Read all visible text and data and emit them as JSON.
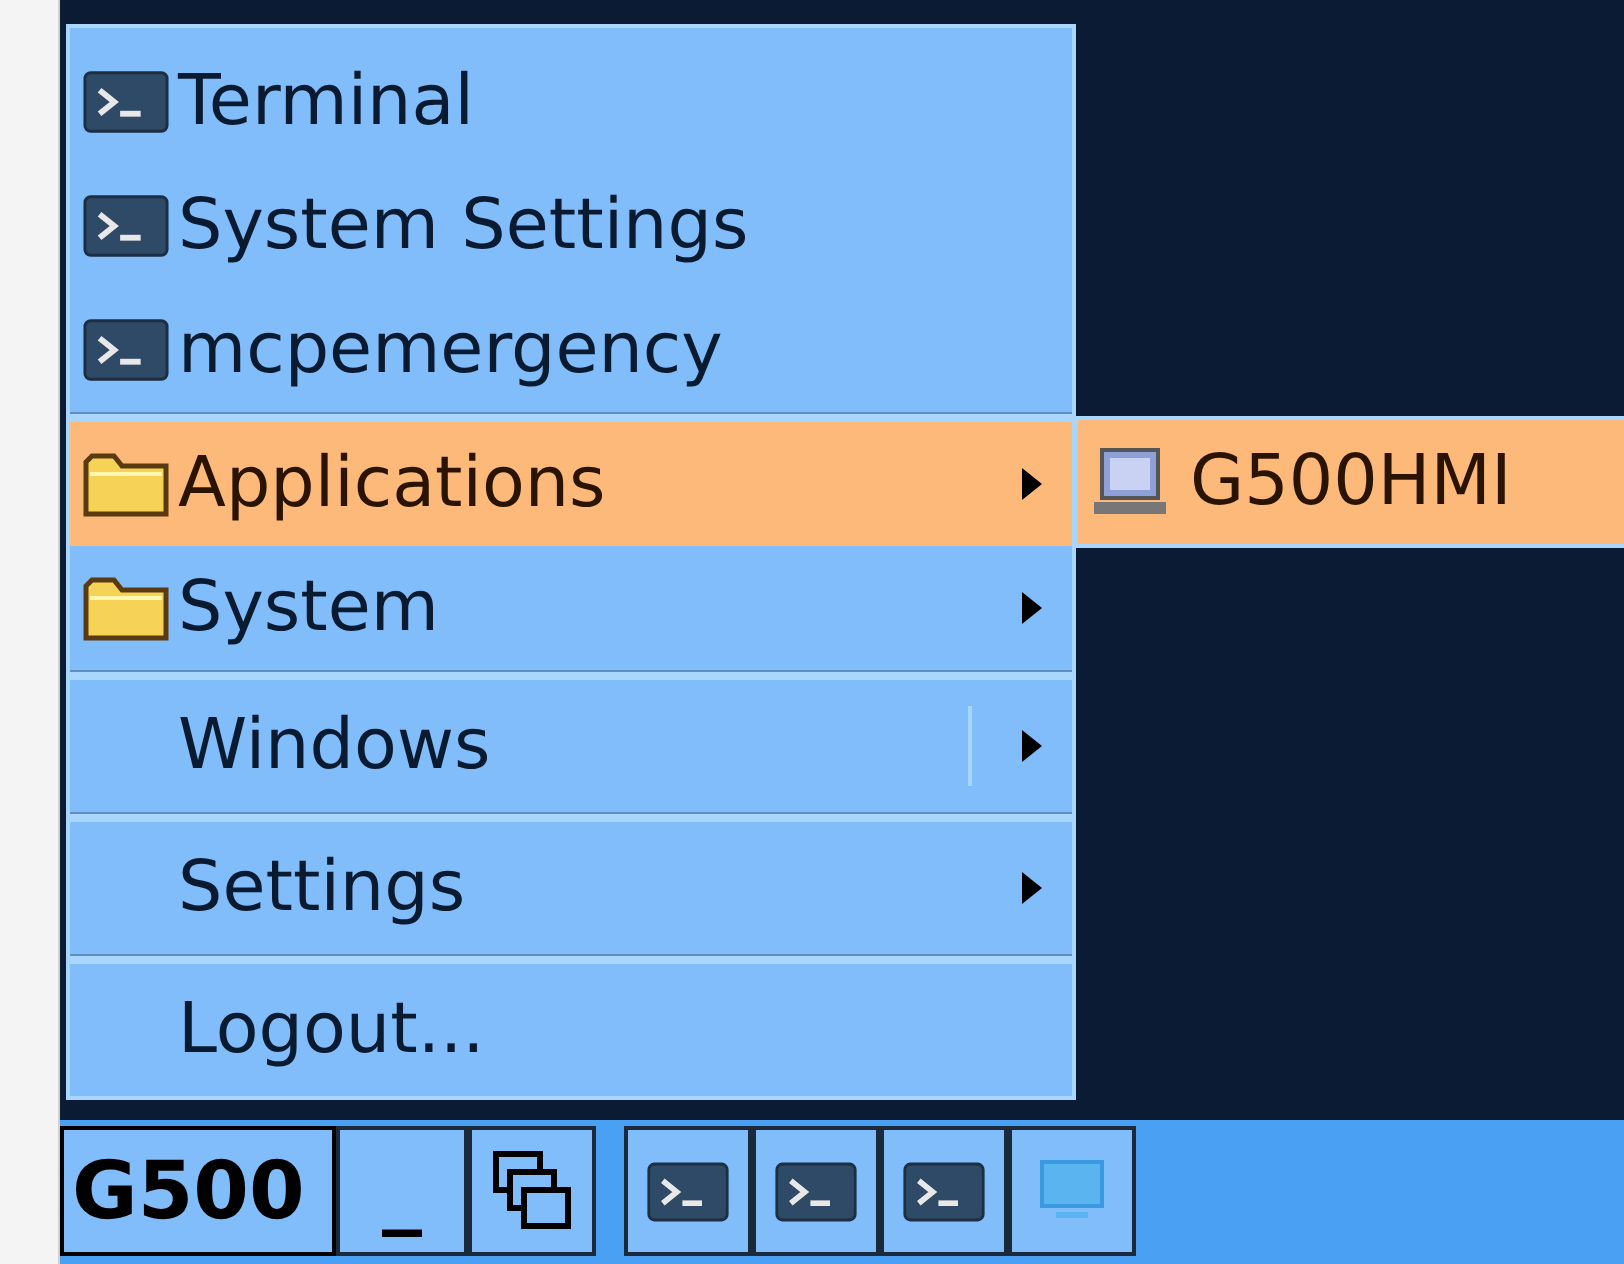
{
  "menu": {
    "items": [
      {
        "kind": "app",
        "label": "Terminal",
        "selected": false,
        "has_submenu": false
      },
      {
        "kind": "app",
        "label": "System Settings",
        "selected": false,
        "has_submenu": false
      },
      {
        "kind": "app",
        "label": "mcpemergency",
        "selected": false,
        "has_submenu": false
      },
      {
        "kind": "folder",
        "label": "Applications",
        "selected": true,
        "has_submenu": true
      },
      {
        "kind": "folder",
        "label": "System",
        "selected": false,
        "has_submenu": true
      },
      {
        "kind": "plain",
        "label": "Windows",
        "selected": false,
        "has_submenu": true
      },
      {
        "kind": "plain",
        "label": "Settings",
        "selected": false,
        "has_submenu": true
      },
      {
        "kind": "plain",
        "label": "Logout...",
        "selected": false,
        "has_submenu": false
      }
    ]
  },
  "submenu": {
    "items": [
      {
        "kind": "computer",
        "label": "G500HMI",
        "selected": true
      }
    ]
  },
  "taskbar": {
    "start_label": "G500",
    "minimize_label": "_",
    "buttons": [
      {
        "kind": "windows"
      },
      {
        "kind": "terminal"
      },
      {
        "kind": "terminal"
      },
      {
        "kind": "terminal"
      },
      {
        "kind": "desktop"
      }
    ]
  }
}
